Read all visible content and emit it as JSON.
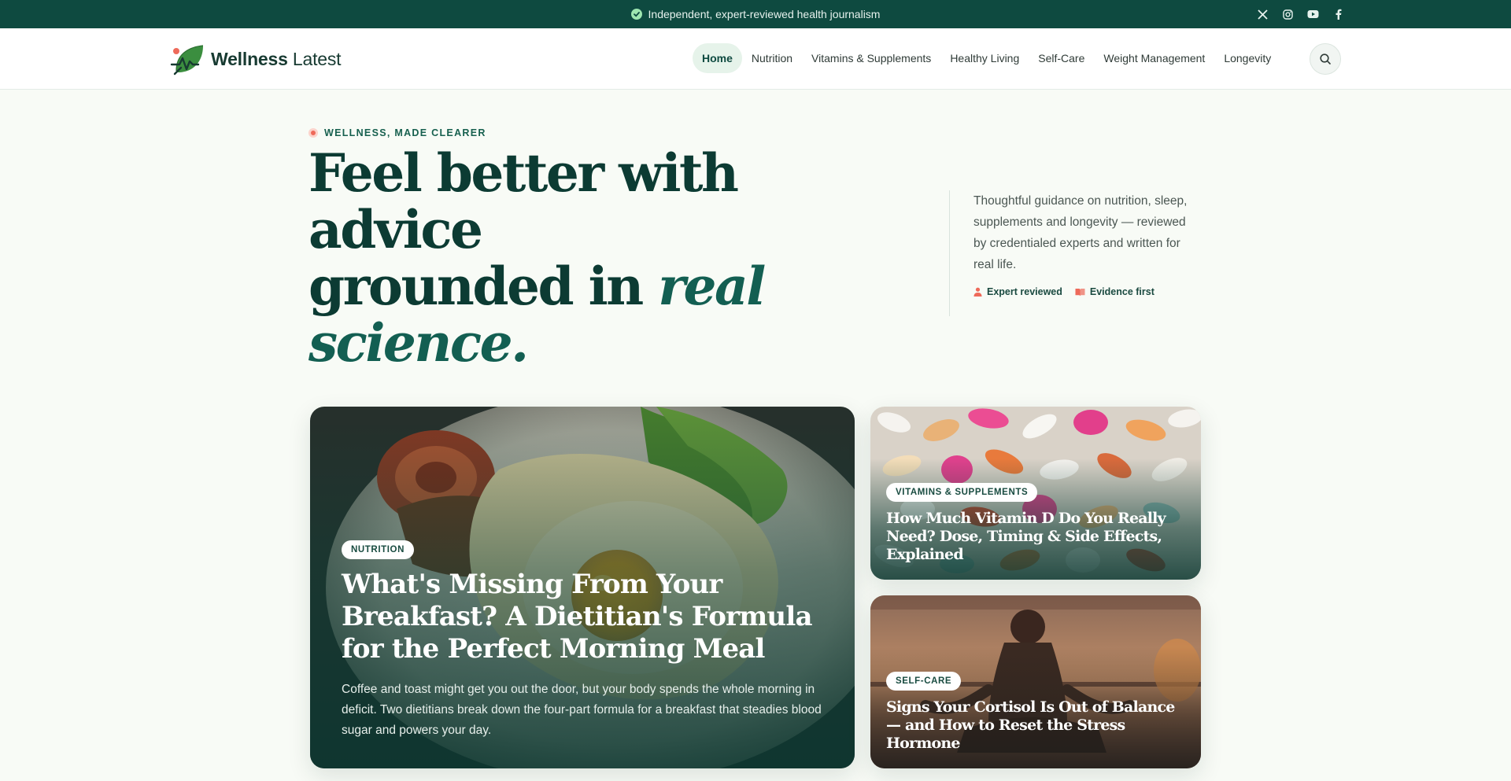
{
  "topbar": {
    "message": "Independent, expert-reviewed health journalism",
    "social_icons": [
      "x-icon",
      "instagram-icon",
      "youtube-icon",
      "facebook-icon"
    ]
  },
  "header": {
    "logo_bold": "Wellness",
    "logo_light": "Latest",
    "nav": [
      {
        "label": "Home",
        "active": true
      },
      {
        "label": "Nutrition"
      },
      {
        "label": "Vitamins & Supplements"
      },
      {
        "label": "Healthy Living"
      },
      {
        "label": "Self-Care"
      },
      {
        "label": "Weight Management"
      },
      {
        "label": "Longevity"
      }
    ],
    "search_icon": "search-icon"
  },
  "hero": {
    "eyebrow": "WELLNESS, MADE CLEARER",
    "headline_1": "Feel better with",
    "headline_2": "advice",
    "headline_3": "grounded in",
    "headline_italic": "real science.",
    "lede": "Thoughtful guidance on nutrition, sleep, supplements and longevity — reviewed by credentialed experts and written for real life.",
    "tag_1": "Expert reviewed",
    "tag_2": "Evidence first"
  },
  "featured": {
    "category": "NUTRITION",
    "title": "What's Missing From Your Breakfast? A Dietitian's Formula for the Perfect Morning Meal",
    "excerpt": "Coffee and toast might get you out the door, but your body spends the whole morning in deficit. Two dietitians break down the four-part formula for a breakfast that steadies blood sugar and powers your day."
  },
  "side_cards": [
    {
      "category": "VITAMINS & SUPPLEMENTS",
      "title": "How Much Vitamin D Do You Really Need? Dose, Timing & Side Effects, Explained"
    },
    {
      "category": "SELF-CARE",
      "title": "Signs Your Cortisol Is Out of Balance — and How to Reset the Stress Hormone"
    }
  ],
  "colors": {
    "brand_dark": "#0e4a40",
    "headline": "#0c3b33",
    "accent": "#ee6a5a",
    "page_bg": "#f8fbf6"
  }
}
